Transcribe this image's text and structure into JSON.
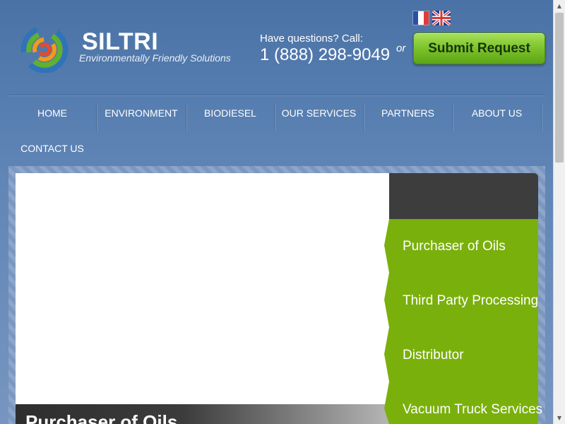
{
  "header": {
    "brand_name": "SILTRI",
    "tagline": "Environmentally Friendly Solutions",
    "questions_label": "Have questions? Call:",
    "phone": "1 (888) 298-9049",
    "or_label": "or",
    "submit_label": "Submit Request",
    "languages": [
      "fr",
      "en"
    ]
  },
  "nav": {
    "items": [
      {
        "label": "HOME"
      },
      {
        "label": "ENVIRONMENT"
      },
      {
        "label": "BIODIESEL"
      },
      {
        "label": "OUR SERVICES"
      },
      {
        "label": "PARTNERS"
      },
      {
        "label": "ABOUT US"
      },
      {
        "label": "CONTACT US"
      }
    ]
  },
  "slider": {
    "caption": "Purchaser of Oils",
    "menu": [
      {
        "label": "Purchaser of Oils"
      },
      {
        "label": "Third Party Processing"
      },
      {
        "label": "Distributor"
      },
      {
        "label": "Vacuum Truck Services"
      }
    ]
  },
  "colors": {
    "background": "#5f85b6",
    "accent_green": "#7ab00c",
    "button_green": "#7cc22a",
    "dark_panel": "#3d3d3d"
  }
}
